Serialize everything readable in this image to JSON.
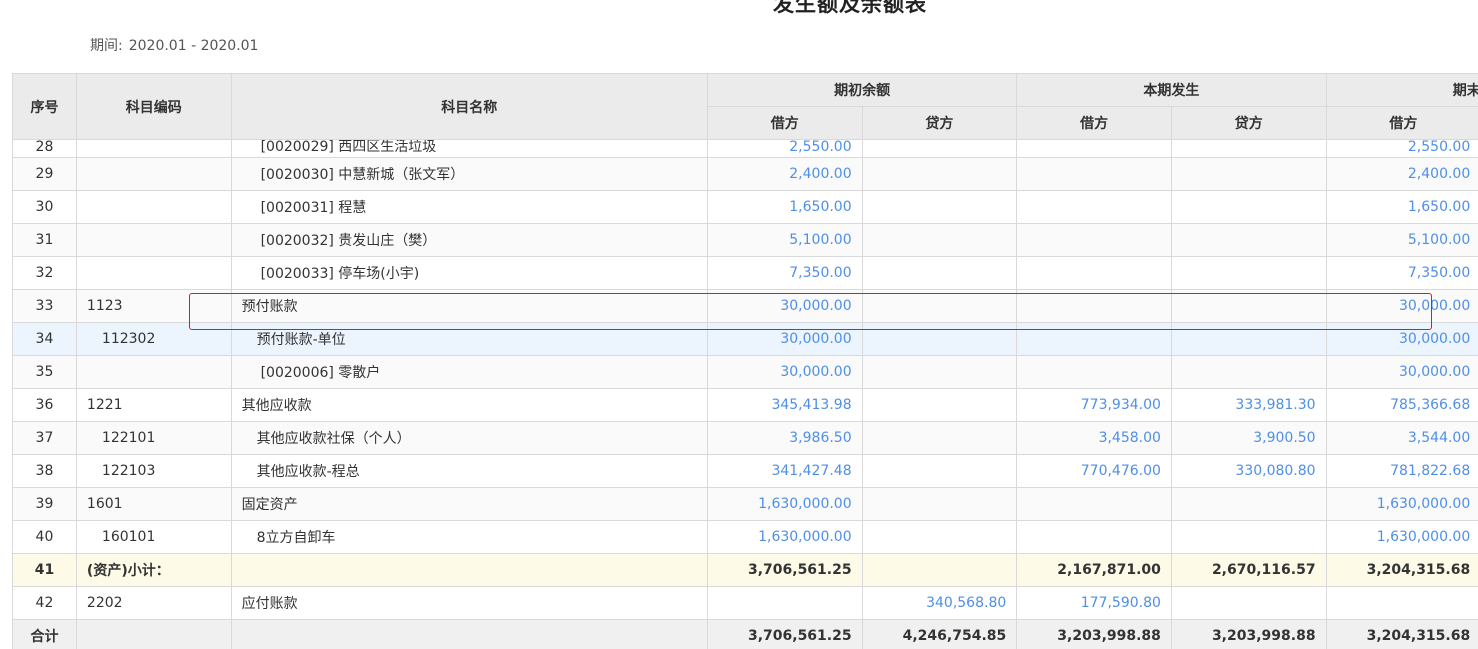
{
  "report": {
    "title": "发生额及余额表",
    "period_label": "期间:",
    "period_value": "2020.01 - 2020.01"
  },
  "headers": {
    "seq": "序号",
    "code": "科目编码",
    "name": "科目名称",
    "opening": "期初余额",
    "current": "本期发生",
    "closing": "期末余额",
    "debit": "借方",
    "credit": "贷方"
  },
  "rows": [
    {
      "seq": "28",
      "code": "",
      "name": "[0020029] 西四区生活垃圾",
      "indent": 2,
      "od": "2,550.00",
      "oc": "",
      "cd": "",
      "cc": "",
      "ed": "2,550.00",
      "type": "normal"
    },
    {
      "seq": "29",
      "code": "",
      "name": "[0020030] 中慧新城（张文军）",
      "indent": 2,
      "od": "2,400.00",
      "oc": "",
      "cd": "",
      "cc": "",
      "ed": "2,400.00",
      "type": "alt"
    },
    {
      "seq": "30",
      "code": "",
      "name": "[0020031] 程慧",
      "indent": 2,
      "od": "1,650.00",
      "oc": "",
      "cd": "",
      "cc": "",
      "ed": "1,650.00",
      "type": "normal"
    },
    {
      "seq": "31",
      "code": "",
      "name": "[0020032] 贵发山庄（樊）",
      "indent": 2,
      "od": "5,100.00",
      "oc": "",
      "cd": "",
      "cc": "",
      "ed": "5,100.00",
      "type": "alt"
    },
    {
      "seq": "32",
      "code": "",
      "name": "[0020033] 停车场(小宇)",
      "indent": 2,
      "od": "7,350.00",
      "oc": "",
      "cd": "",
      "cc": "",
      "ed": "7,350.00",
      "type": "normal"
    },
    {
      "seq": "33",
      "code": "1123",
      "name": "预付账款",
      "indent": 0,
      "od": "30,000.00",
      "oc": "",
      "cd": "",
      "cc": "",
      "ed": "30,000.00",
      "type": "alt"
    },
    {
      "seq": "34",
      "code": "112302",
      "name": "预付账款-单位",
      "indent": 1,
      "od": "30,000.00",
      "oc": "",
      "cd": "",
      "cc": "",
      "ed": "30,000.00",
      "type": "hl"
    },
    {
      "seq": "35",
      "code": "",
      "name": "[0020006] 零散户",
      "indent": 2,
      "od": "30,000.00",
      "oc": "",
      "cd": "",
      "cc": "",
      "ed": "30,000.00",
      "type": "alt"
    },
    {
      "seq": "36",
      "code": "1221",
      "name": "其他应收款",
      "indent": 0,
      "od": "345,413.98",
      "oc": "",
      "cd": "773,934.00",
      "cc": "333,981.30",
      "ed": "785,366.68",
      "type": "normal"
    },
    {
      "seq": "37",
      "code": "122101",
      "name": "其他应收款社保（个人）",
      "indent": 1,
      "od": "3,986.50",
      "oc": "",
      "cd": "3,458.00",
      "cc": "3,900.50",
      "ed": "3,544.00",
      "type": "alt"
    },
    {
      "seq": "38",
      "code": "122103",
      "name": "其他应收款-程总",
      "indent": 1,
      "od": "341,427.48",
      "oc": "",
      "cd": "770,476.00",
      "cc": "330,080.80",
      "ed": "781,822.68",
      "type": "normal"
    },
    {
      "seq": "39",
      "code": "1601",
      "name": "固定资产",
      "indent": 0,
      "od": "1,630,000.00",
      "oc": "",
      "cd": "",
      "cc": "",
      "ed": "1,630,000.00",
      "type": "alt"
    },
    {
      "seq": "40",
      "code": "160101",
      "name": "8立方自卸车",
      "indent": 1,
      "od": "1,630,000.00",
      "oc": "",
      "cd": "",
      "cc": "",
      "ed": "1,630,000.00",
      "type": "normal"
    },
    {
      "seq": "41",
      "code": "(资产)小计：",
      "name": "",
      "indent": 0,
      "od": "3,706,561.25",
      "oc": "",
      "cd": "2,167,871.00",
      "cc": "2,670,116.57",
      "ed": "3,204,315.68",
      "type": "sub"
    },
    {
      "seq": "42",
      "code": "2202",
      "name": "应付账款",
      "indent": 0,
      "od": "",
      "oc": "340,568.80",
      "cd": "177,590.80",
      "cc": "",
      "ed": "",
      "type": "normal"
    },
    {
      "seq": "合计",
      "code": "",
      "name": "",
      "indent": 0,
      "od": "3,706,561.25",
      "oc": "4,246,754.85",
      "cd": "3,203,998.88",
      "cc": "3,203,998.88",
      "ed": "3,204,315.68",
      "type": "total"
    }
  ]
}
